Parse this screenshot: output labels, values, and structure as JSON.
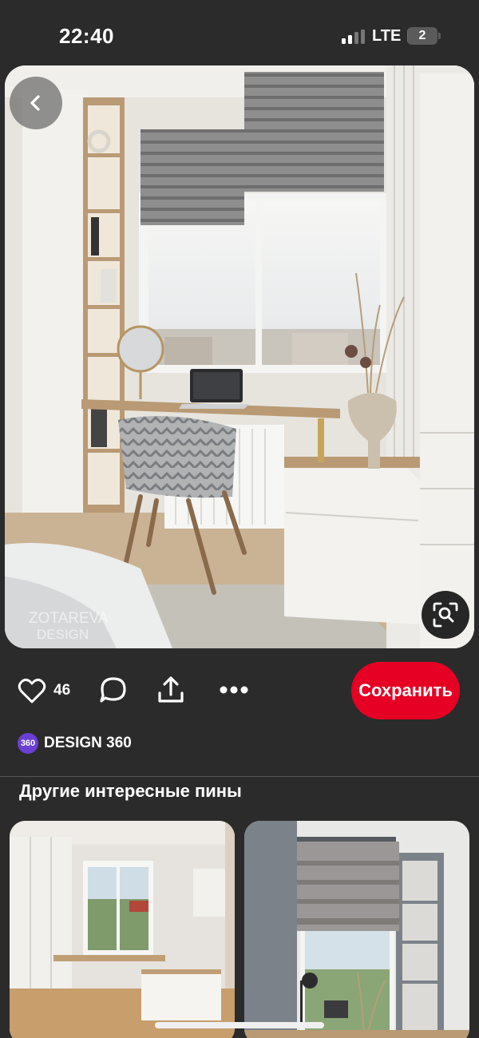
{
  "status_bar": {
    "time": "22:40",
    "network": "LTE",
    "battery_level": "2",
    "battery_fraction": 0.02,
    "battery_color": "#e53935"
  },
  "pin": {
    "image_label": "Интерьер детской комнаты с рабочим местом у окна",
    "watermark": [
      "ZOTAREVA",
      "DESIGN"
    ],
    "back_icon": "chevron-left-icon",
    "lens_icon": "visual-search-icon"
  },
  "actions": {
    "like_icon": "heart-icon",
    "like_count": "46",
    "comment_icon": "comment-bubble-icon",
    "share_icon": "share-upload-icon",
    "more_icon": "more-dots-icon",
    "save_label": "Сохранить",
    "save_color": "#e60023"
  },
  "author": {
    "avatar_text": "360",
    "name": "DESIGN 360",
    "avatar_color": "#6b3fd4"
  },
  "related": {
    "title": "Другие интересные пины",
    "pins": [
      {
        "label": "Белая комната с рабочим местом у окна"
      },
      {
        "label": "Рабочее место у окна с римскими шторами"
      }
    ]
  }
}
